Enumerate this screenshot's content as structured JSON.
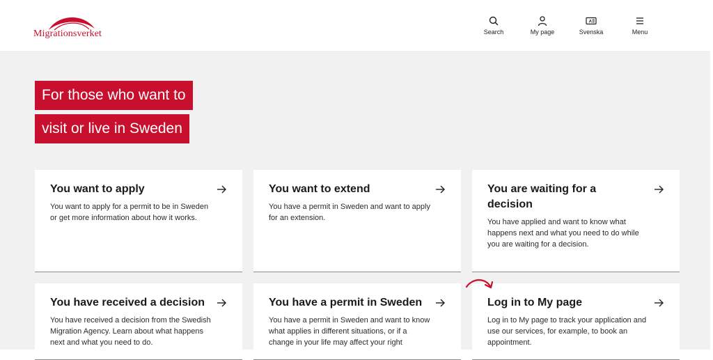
{
  "brand": {
    "logo_text": "Migrationsverket",
    "color": "#c8102e"
  },
  "nav": [
    {
      "label": "Search",
      "icon": "search-icon"
    },
    {
      "label": "My page",
      "icon": "user-icon"
    },
    {
      "label": "Svenska",
      "icon": "language-icon"
    },
    {
      "label": "Menu",
      "icon": "hamburger-icon"
    }
  ],
  "hero": {
    "line1": "For those who want to",
    "line2": "visit or live in Sweden"
  },
  "cards": [
    {
      "title": "You want to apply",
      "desc": "You want to apply for a permit to be in Sweden or get more information about how it works."
    },
    {
      "title": "You want to extend",
      "desc": "You have a permit in Sweden and want to apply for an extension."
    },
    {
      "title": "You are waiting for a decision",
      "desc": "You have applied and want to know what happens next and what you need to do while you are waiting for a decision."
    },
    {
      "title": "You have received a decision",
      "desc": "You have received a decision from the Swedish Migration Agency. Learn about what happens next and what you need to do."
    },
    {
      "title": "You have a permit in Sweden",
      "desc": "You have a permit in Sweden and want to know what applies in different situations, or if a change in your life may affect your right"
    },
    {
      "title": "Log in to My page",
      "desc": "Log in to My page to track your application and use our services, for example, to book an appointment."
    }
  ]
}
